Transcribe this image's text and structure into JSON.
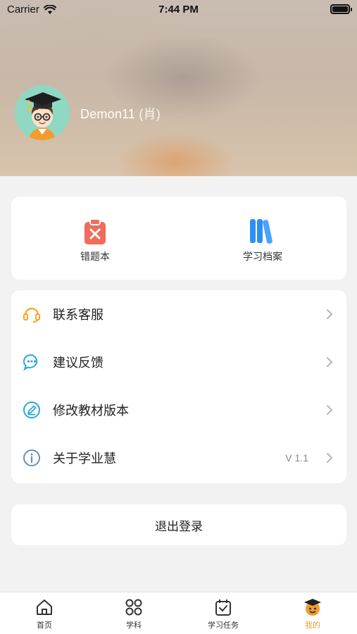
{
  "status_bar": {
    "carrier": "Carrier",
    "time": "7:44 PM"
  },
  "profile": {
    "name": "Demon11",
    "tag": "(肖)",
    "avatar_icon": "cartoon-boy-graduation-cap-avatar"
  },
  "quick_actions": [
    {
      "label": "错题本",
      "icon": "clipboard-x-icon",
      "color": "#f26b5b"
    },
    {
      "label": "学习档案",
      "icon": "books-icon",
      "color": "#2f8ef4"
    }
  ],
  "menu": [
    {
      "label": "联系客服",
      "icon": "headset-icon",
      "value": ""
    },
    {
      "label": "建议反馈",
      "icon": "chat-bubble-icon",
      "value": ""
    },
    {
      "label": "修改教材版本",
      "icon": "edit-pen-icon",
      "value": ""
    },
    {
      "label": "关于学业慧",
      "icon": "info-icon",
      "value": "V 1.1"
    }
  ],
  "logout": {
    "label": "退出登录"
  },
  "tabs": [
    {
      "label": "首页",
      "icon": "home-icon"
    },
    {
      "label": "学科",
      "icon": "grid-icon"
    },
    {
      "label": "学习任务",
      "icon": "calendar-check-icon"
    },
    {
      "label": "我的",
      "icon": "profile-face-icon",
      "active": true
    }
  ],
  "colors": {
    "accent": "#f39c2d",
    "menu_icon": "#2aa7df",
    "headset_icon": "#f5a623"
  }
}
